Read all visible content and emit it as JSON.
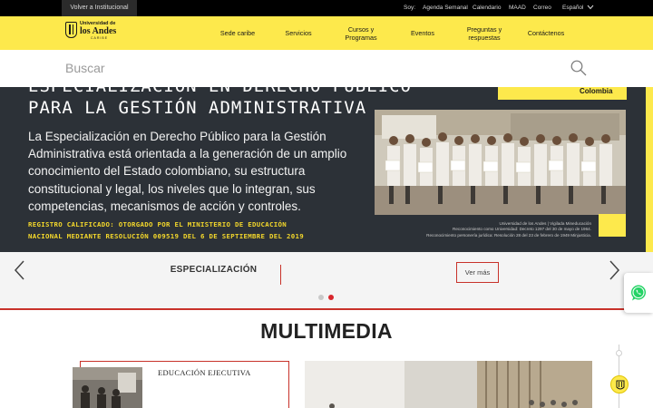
{
  "topbar": {
    "back_link": "Volver a Institucional",
    "soy_label": "Soy:",
    "links": [
      "Agenda Semanal",
      "Calendario",
      "MAAD",
      "Correo"
    ],
    "language": "Español"
  },
  "logo": {
    "line1": "Universidad de",
    "line2": "los Andes",
    "line3": "CARIBE"
  },
  "nav": {
    "items": [
      {
        "line1": "Sede caribe",
        "line2": ""
      },
      {
        "line1": "Servicios",
        "line2": ""
      },
      {
        "line1": "Cursos y",
        "line2": "Programas"
      },
      {
        "line1": "Eventos",
        "line2": ""
      },
      {
        "line1": "Preguntas y",
        "line2": "respuestas"
      },
      {
        "line1": "Contáctenos",
        "line2": ""
      }
    ]
  },
  "search": {
    "placeholder": "Buscar"
  },
  "hero": {
    "title_line1": "ESPECIALIZACIÓN EN DERECHO PÚBLICO",
    "title_line2": "PARA LA GESTIÓN ADMINISTRATIVA",
    "description": "La Especialización en Derecho Público para la Gestión Administrativa está orientada a la generación de un amplio conocimiento del Estado colombiano, su estructura constitucional y legal, los niveles que lo integran, sus competencias, mecanismos de acción y controles.",
    "registry_line1": "REGISTRO CALIFICADO: OTORGADO POR EL MINISTERIO DE EDUCACIÓN",
    "registry_line2": "NACIONAL MEDIANTE RESOLUCIÓN 009519 DEL 6 DE SEPTIEMBRE DEL 2019",
    "tag": "Colombia",
    "caption_line1": "Universidad de los Andes | Vigilada Mineducación",
    "caption_line2": "Reconocimiento como Universidad: Decreto 1297 del 30 de mayo de 1964.",
    "caption_line3": "Reconocimiento personería jurídica: Resolución 28 del 23 de febrero de 1949 Minjusticia."
  },
  "slider": {
    "label": "ESPECIALIZACIÓN",
    "more_button": "Ver más",
    "slide_count": 2,
    "active_slide": 2
  },
  "multimedia": {
    "title": "MULTIMEDIA",
    "card_title": "EDUCACIÓN EJECUTIVA"
  },
  "colors": {
    "brand_yellow": "#fde94c",
    "accent_red": "#c8322a",
    "hero_bg": "#2c3137",
    "topbar_bg": "#000000",
    "whatsapp_green": "#25d366"
  },
  "icons": [
    "search-icon",
    "chevron-down-icon",
    "arrow-left-icon",
    "arrow-right-icon",
    "whatsapp-icon"
  ]
}
